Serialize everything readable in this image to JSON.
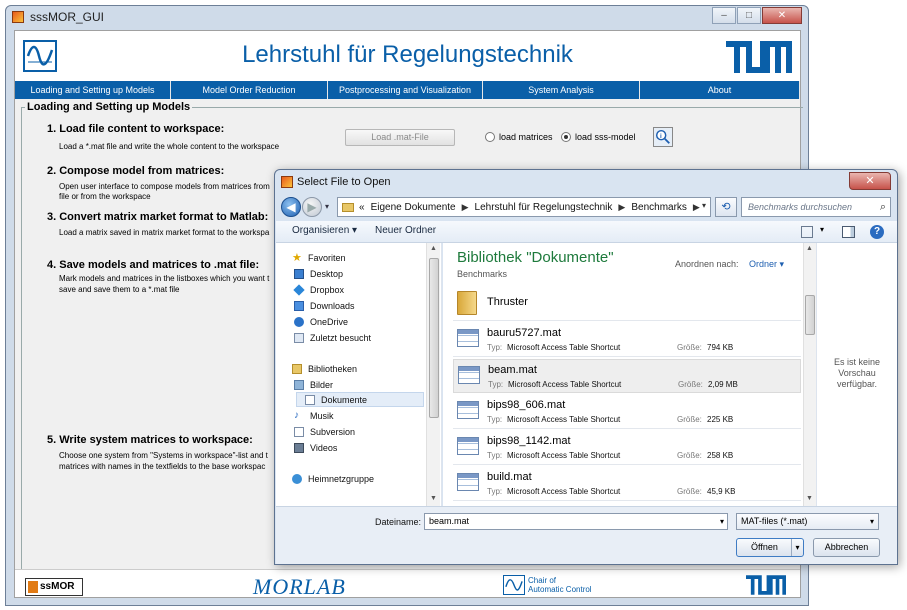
{
  "main_window": {
    "title": "sssMOR_GUI",
    "header_title": "Lehrstuhl für Regelungstechnik",
    "menu": [
      "Loading and Setting up Models",
      "Model Order Reduction",
      "Postprocessing and Visualization",
      "System Analysis",
      "About"
    ],
    "panel_title": "Loading and Setting up Models",
    "steps": {
      "s1_title": "1. Load file content to workspace:",
      "s1_desc": "Load a *.mat file and write the whole content to the workspace",
      "s2_title": "2. Compose model from matrices:",
      "s2_desc1": "Open user interface to compose models from matrices  from",
      "s2_desc2": "file or from the workspace",
      "s3_title": "3. Convert matrix market format to Matlab:",
      "s3_desc": "Load a matrix saved in matrix market format to the workspa",
      "s4_title": "4. Save models and matrices to .mat file:",
      "s4_desc1": "Mark models and matrices in the listboxes which you want t",
      "s4_desc2": "save and save them to a *.mat file",
      "s5_title": "5. Write system matrices to workspace:",
      "s5_desc1": "Choose one system from \"Systems in workspace\"-list and t",
      "s5_desc2": "matrices with names in the textfields to the base workspac"
    },
    "load_button": "Load .mat-File",
    "radio_matrices": "load matrices",
    "radio_sss": "load sss-model",
    "footer": {
      "sss_logo": "ssMOR",
      "morlab": "MORLAB",
      "chair_line1": "Chair of",
      "chair_line2": "Automatic Control"
    },
    "colors": {
      "brand_blue": "#0a5fa8",
      "accent_orange": "#e17b16"
    }
  },
  "dialog": {
    "title": "Select File to Open",
    "close_label": "✕",
    "address": {
      "prefix": "«",
      "crumbs": [
        "Eigene Dokumente",
        "Lehrstuhl für Regelungstechnik",
        "Benchmarks"
      ]
    },
    "search_placeholder": "Benchmarks durchsuchen",
    "toolbar": {
      "organize": "Organisieren ▾",
      "new_folder": "Neuer Ordner"
    },
    "nav": {
      "favorites": "Favoriten",
      "desktop": "Desktop",
      "dropbox": "Dropbox",
      "downloads": "Downloads",
      "onedrive": "OneDrive",
      "recent": "Zuletzt besucht",
      "libraries": "Bibliotheken",
      "pictures": "Bilder",
      "documents": "Dokumente",
      "music": "Musik",
      "subversion": "Subversion",
      "videos": "Videos",
      "homegroup": "Heimnetzgruppe"
    },
    "library_title": "Bibliothek \"Dokumente\"",
    "library_sub": "Benchmarks",
    "arrange_label": "Anordnen nach:",
    "arrange_value": "Ordner ▾",
    "type_label": "Typ:",
    "size_label": "Größe:",
    "folder": "Thruster",
    "files": [
      {
        "name": "bauru5727.mat",
        "type": "Microsoft Access Table Shortcut",
        "size": "794 KB"
      },
      {
        "name": "beam.mat",
        "type": "Microsoft Access Table Shortcut",
        "size": "2,09 MB"
      },
      {
        "name": "bips98_606.mat",
        "type": "Microsoft Access Table Shortcut",
        "size": "225 KB"
      },
      {
        "name": "bips98_1142.mat",
        "type": "Microsoft Access Table Shortcut",
        "size": "258 KB"
      },
      {
        "name": "build.mat",
        "type": "Microsoft Access Table Shortcut",
        "size": "45,9 KB"
      }
    ],
    "preview_line1": "Es ist keine",
    "preview_line2": "Vorschau",
    "preview_line3": "verfügbar.",
    "filename_label": "Dateiname:",
    "filename_value": "beam.mat",
    "filter_value": "MAT-files (*.mat)",
    "open_button": "Öffnen",
    "cancel_button": "Abbrechen"
  }
}
